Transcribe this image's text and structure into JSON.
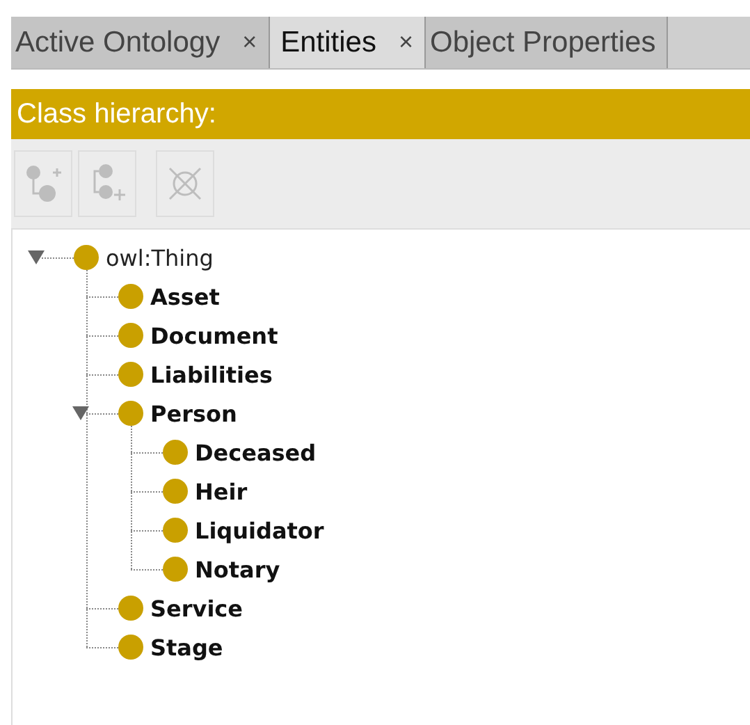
{
  "tabs": [
    {
      "label": "Active Ontology",
      "close": "×",
      "selected": false
    },
    {
      "label": "Entities",
      "close": "×",
      "selected": true
    },
    {
      "label": "Object Properties",
      "selected": false
    }
  ],
  "panel": {
    "title": "Class hierarchy:"
  },
  "toolbar": [
    {
      "kind": "add-subclass",
      "disabled": true
    },
    {
      "kind": "add-sibling",
      "disabled": true
    },
    {
      "kind": "delete",
      "disabled": true
    }
  ],
  "tree": [
    {
      "label": "owl:Thing",
      "kind": "root",
      "expanded": true,
      "children": [
        {
          "label": "Asset",
          "kind": "class"
        },
        {
          "label": "Document",
          "kind": "class"
        },
        {
          "label": "Liabilities",
          "kind": "class"
        },
        {
          "label": "Person",
          "kind": "class",
          "expanded": true,
          "children": [
            {
              "label": "Deceased",
              "kind": "class"
            },
            {
              "label": "Heir",
              "kind": "class"
            },
            {
              "label": "Liquidator",
              "kind": "class"
            },
            {
              "label": "Notary",
              "kind": "class"
            }
          ]
        },
        {
          "label": "Service",
          "kind": "class"
        },
        {
          "label": "Stage",
          "kind": "class"
        }
      ]
    }
  ]
}
